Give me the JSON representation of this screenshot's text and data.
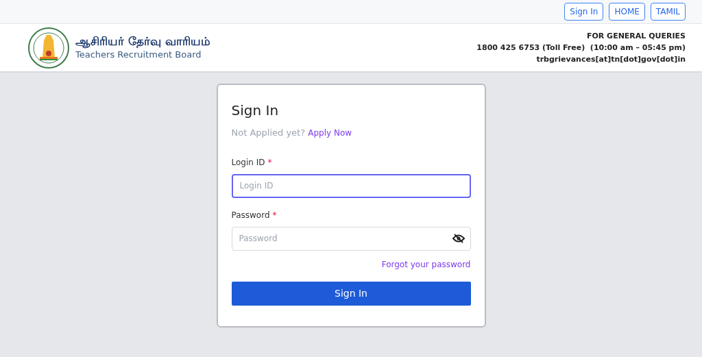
{
  "top_bar": {
    "buttons": [
      "Sign In",
      "HOME",
      "TAMIL"
    ]
  },
  "header": {
    "title_tamil": "ஆசிரியர் தேர்வு வாரியம்",
    "title_english": "Teachers Recruitment Board",
    "contact": [
      "FOR GENERAL QUERIES",
      "1800 425 6753 (Toll Free)  (10:00 am – 05:45 pm)",
      "trbgrievances[at]tn[dot]gov[dot]in"
    ]
  },
  "login_card": {
    "title": "Sign In",
    "prompt": "Not Applied yet?",
    "apply_link": "Apply Now",
    "fields": [
      {
        "label": "Login ID",
        "required_mark": "*",
        "placeholder": "Login ID",
        "focused": true,
        "kind": "text"
      },
      {
        "label": "Password",
        "required_mark": "*",
        "placeholder": "Password",
        "focused": false,
        "kind": "password"
      }
    ],
    "forgot_link": "Forgot your password",
    "submit": "Sign In"
  }
}
